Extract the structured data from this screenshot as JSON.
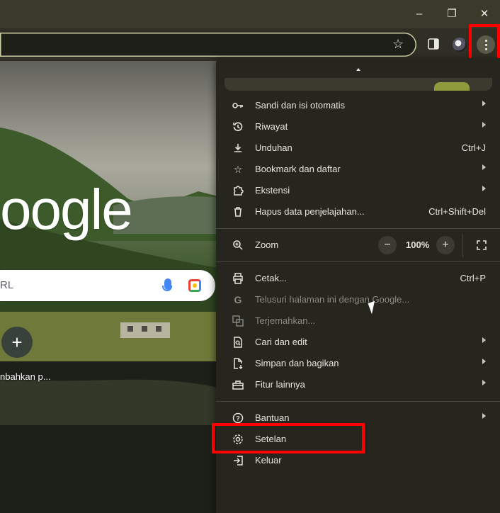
{
  "window": {
    "controls": {
      "minimize": "–",
      "restore": "❐",
      "close": "✕"
    }
  },
  "toolbar": {
    "bookmark_icon": "star-icon",
    "side_panel_icon": "side-panel-icon",
    "profile_icon": "avatar",
    "menu_icon": "kebab-menu-icon"
  },
  "ntp": {
    "logo_text": "oogle",
    "search_placeholder": "RL",
    "add_shortcut_label": "nbahkan p...",
    "add_shortcut_icon": "+"
  },
  "menu": {
    "items": [
      {
        "label": "Sandi dan isi otomatis",
        "icon": "key-icon",
        "submenu": true
      },
      {
        "label": "Riwayat",
        "icon": "history-icon",
        "submenu": true
      },
      {
        "label": "Unduhan",
        "icon": "download-icon",
        "shortcut": "Ctrl+J"
      },
      {
        "label": "Bookmark dan daftar",
        "icon": "star-icon",
        "submenu": true
      },
      {
        "label": "Ekstensi",
        "icon": "puzzle-icon",
        "submenu": true
      },
      {
        "label": "Hapus data penjelajahan...",
        "icon": "trash-icon",
        "shortcut": "Ctrl+Shift+Del"
      },
      {
        "label": "Zoom",
        "icon": "zoom-icon"
      },
      {
        "label": "Cetak...",
        "icon": "print-icon",
        "shortcut": "Ctrl+P"
      },
      {
        "label": "Telusuri halaman ini dengan Google...",
        "icon": "google-icon",
        "disabled": true
      },
      {
        "label": "Terjemahkan...",
        "icon": "translate-icon",
        "disabled": true
      },
      {
        "label": "Cari dan edit",
        "icon": "find-icon",
        "submenu": true
      },
      {
        "label": "Simpan dan bagikan",
        "icon": "save-share-icon",
        "submenu": true
      },
      {
        "label": "Fitur lainnya",
        "icon": "toolbox-icon",
        "submenu": true
      },
      {
        "label": "Bantuan",
        "icon": "help-icon",
        "submenu": true
      },
      {
        "label": "Setelan",
        "icon": "gear-icon"
      },
      {
        "label": "Keluar",
        "icon": "exit-icon"
      }
    ],
    "zoom": {
      "minus": "−",
      "value": "100%",
      "plus": "+"
    }
  },
  "colors": {
    "highlight": "#ff0000",
    "menu_bg": "#26261f",
    "toolbar_bg": "#2f2f25"
  }
}
